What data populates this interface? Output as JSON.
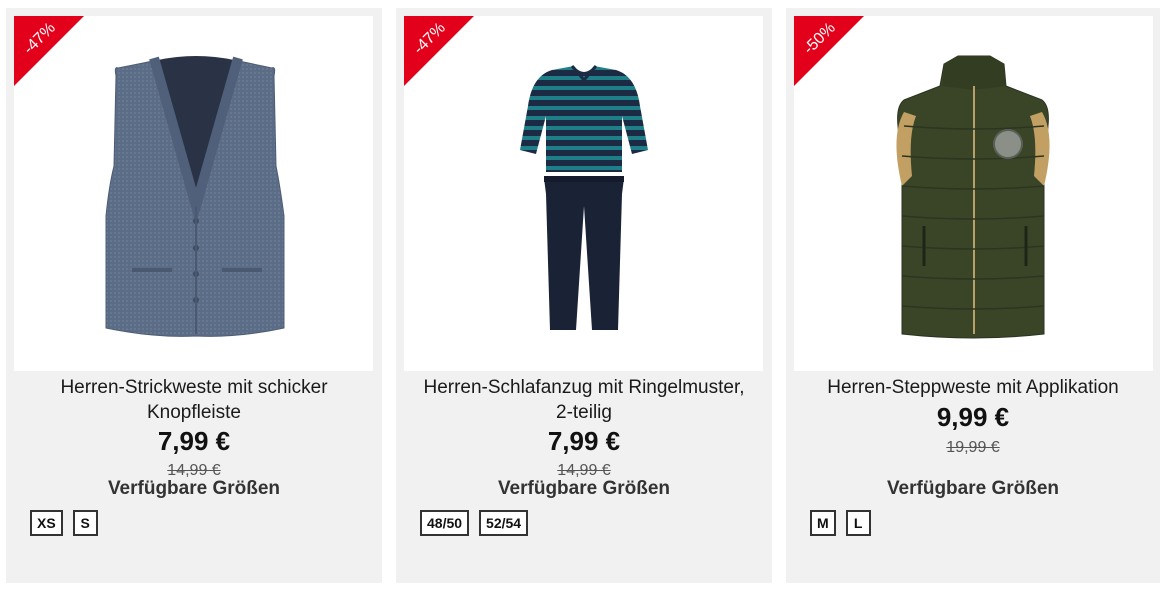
{
  "products": [
    {
      "discount": "-47%",
      "title": "Herren-Strickweste mit schicker Knopfleiste",
      "price": "7,99 €",
      "old_price": "14,99 €",
      "sizes_label": "Verfügbare Größen",
      "sizes": [
        "XS",
        "S"
      ]
    },
    {
      "discount": "-47%",
      "title": "Herren-Schlafanzug mit Ringelmuster, 2-teilig",
      "price": "7,99 €",
      "old_price": "14,99 €",
      "sizes_label": "Verfügbare Größen",
      "sizes": [
        "48/50",
        "52/54"
      ]
    },
    {
      "discount": "-50%",
      "title": "Herren-Steppweste mit Applikation",
      "price": "9,99 €",
      "old_price": "19,99 €",
      "sizes_label": "Verfügbare Größen",
      "sizes": [
        "M",
        "L"
      ]
    }
  ],
  "colors": {
    "badge": "#e2001a",
    "card_bg": "#f1f1f1"
  }
}
